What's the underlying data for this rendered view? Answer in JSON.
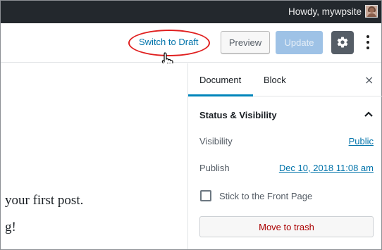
{
  "admin_bar": {
    "greeting": "Howdy, mywpsite",
    "avatar_icon": "user-avatar"
  },
  "toolbar": {
    "switch_to_draft": "Switch to Draft",
    "preview": "Preview",
    "update": "Update",
    "settings_icon": "gear-icon",
    "more_icon": "vertical-ellipsis-icon",
    "highlight_color": "#e02020"
  },
  "content": {
    "paragraphs": [
      " your first post.",
      "g!"
    ]
  },
  "sidebar": {
    "tabs": [
      {
        "label": "Document",
        "active": true
      },
      {
        "label": "Block",
        "active": false
      }
    ],
    "close_icon": "×",
    "panel": {
      "title": "Status & Visibility",
      "visibility_label": "Visibility",
      "visibility_value": "Public",
      "publish_label": "Publish",
      "publish_value": "Dec 10, 2018 11:08 am",
      "sticky_label": "Stick to the Front Page",
      "sticky_checked": false,
      "trash_label": "Move to trash"
    }
  },
  "colors": {
    "accent": "#0085ba",
    "link": "#0073aa",
    "danger": "#aa0000",
    "admin_bar": "#23282d"
  }
}
